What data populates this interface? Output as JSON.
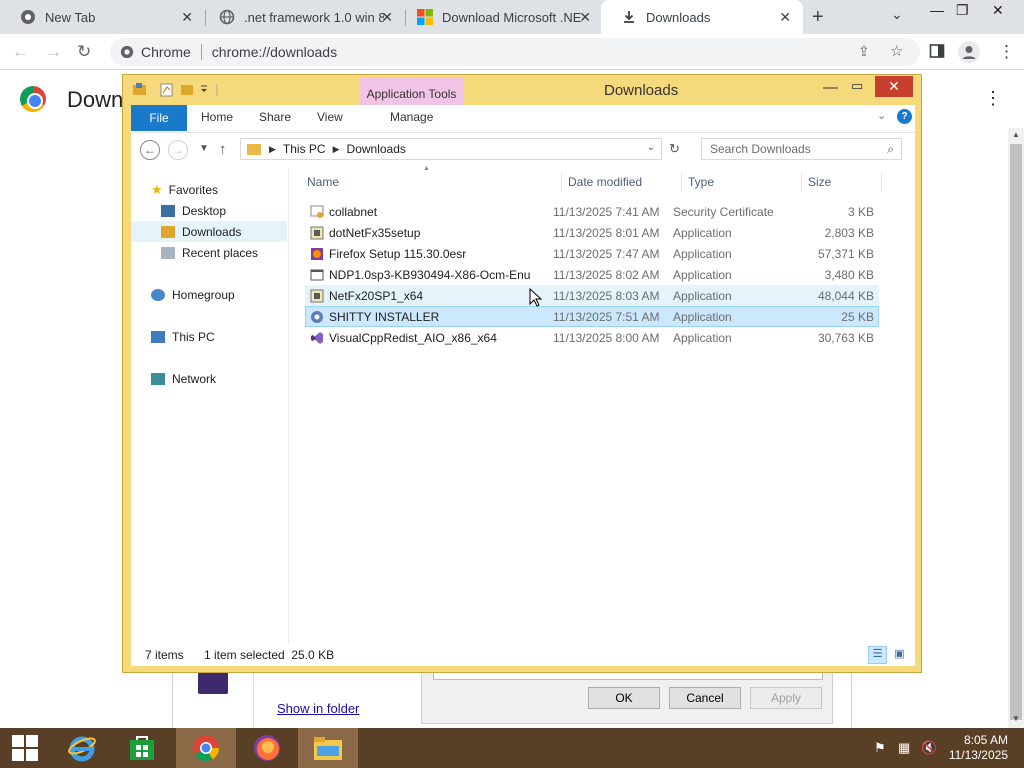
{
  "chrome": {
    "tabs": [
      {
        "title": "New Tab",
        "icon": "chrome-icon"
      },
      {
        "title": ".net framework 1.0 win 8",
        "icon": "globe-icon"
      },
      {
        "title": "Download Microsoft .NET",
        "icon": "microsoft-icon"
      },
      {
        "title": "Downloads",
        "icon": "download-icon",
        "active": true
      }
    ],
    "omnibox": {
      "chip": "Chrome",
      "url": "chrome://downloads"
    },
    "page_title": "Down"
  },
  "explorer": {
    "title": "Downloads",
    "contextual_tab": "Application Tools",
    "ribbon_tabs": [
      "File",
      "Home",
      "Share",
      "View",
      "Manage"
    ],
    "breadcrumb": [
      "This PC",
      "Downloads"
    ],
    "search_placeholder": "Search Downloads",
    "nav": {
      "favorites": "Favorites",
      "desktop": "Desktop",
      "downloads": "Downloads",
      "recent": "Recent places",
      "homegroup": "Homegroup",
      "thispc": "This PC",
      "network": "Network"
    },
    "columns": [
      "Name",
      "Date modified",
      "Type",
      "Size"
    ],
    "files": [
      {
        "name": "collabnet",
        "date": "11/13/2025 7:41 AM",
        "type": "Security Certificate",
        "size": "3 KB",
        "icon": "certificate-icon"
      },
      {
        "name": "dotNetFx35setup",
        "date": "11/13/2025 8:01 AM",
        "type": "Application",
        "size": "2,803 KB",
        "icon": "installer-icon"
      },
      {
        "name": "Firefox Setup 115.30.0esr",
        "date": "11/13/2025 7:47 AM",
        "type": "Application",
        "size": "57,371 KB",
        "icon": "firefox-icon"
      },
      {
        "name": "NDP1.0sp3-KB930494-X86-Ocm-Enu",
        "date": "11/13/2025 8:02 AM",
        "type": "Application",
        "size": "3,480 KB",
        "icon": "app-icon"
      },
      {
        "name": "NetFx20SP1_x64",
        "date": "11/13/2025 8:03 AM",
        "type": "Application",
        "size": "48,044 KB",
        "icon": "installer-icon",
        "state": "hover"
      },
      {
        "name": "SHITTY INSTALLER",
        "date": "11/13/2025 7:51 AM",
        "type": "Application",
        "size": "25 KB",
        "icon": "setup-icon",
        "state": "selected"
      },
      {
        "name": "VisualCppRedist_AIO_x86_x64",
        "date": "11/13/2025 8:00 AM",
        "type": "Application",
        "size": "30,763 KB",
        "icon": "visualstudio-icon"
      }
    ],
    "status": {
      "count": "7 items",
      "selection": "1 item selected  25.0 KB"
    }
  },
  "dialog": {
    "show_in_folder": "Show in folder",
    "ok": "OK",
    "cancel": "Cancel",
    "apply": "Apply"
  },
  "taskbar": {
    "time": "8:05 AM",
    "date": "11/13/2025"
  },
  "colors": {
    "explorer_frame": "#f5d97a",
    "file_tab": "#1979ca",
    "close": "#c7402d",
    "taskbar": "#5a3f27",
    "selection": "#cce8ff"
  }
}
